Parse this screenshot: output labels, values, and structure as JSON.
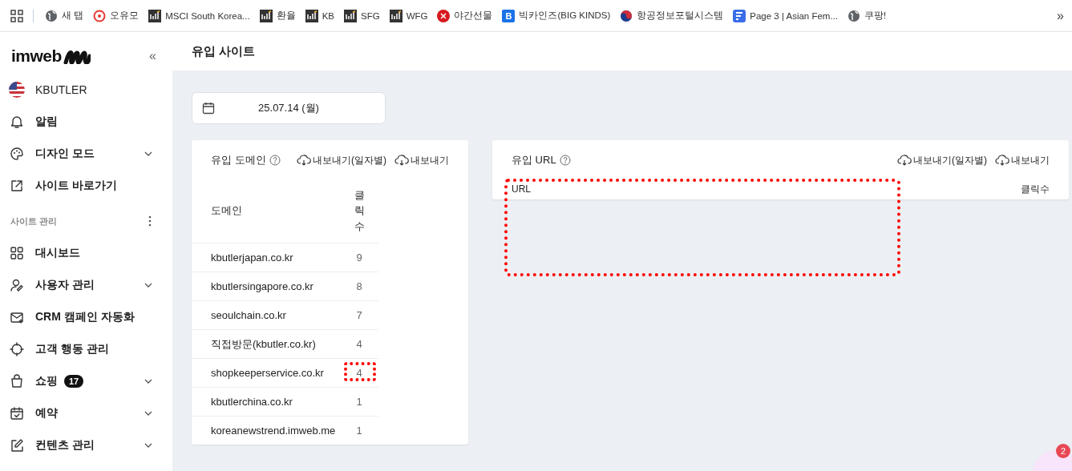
{
  "bookmarks_bar": {
    "items": [
      {
        "kind": "apps"
      },
      {
        "kind": "globe",
        "label": "새 탭"
      },
      {
        "kind": "cafe",
        "label": "오유모"
      },
      {
        "kind": "inv",
        "label": "MSCI South Korea..."
      },
      {
        "kind": "inv",
        "label": "환율"
      },
      {
        "kind": "inv",
        "label": "KB"
      },
      {
        "kind": "inv",
        "label": "SFG"
      },
      {
        "kind": "inv",
        "label": "WFG"
      },
      {
        "kind": "red",
        "label": "야간선물"
      },
      {
        "kind": "letter",
        "label": "빅카인즈(BIG KINDS)",
        "icon_text": "B"
      },
      {
        "kind": "gov",
        "label": "항공정보포털시스템"
      },
      {
        "kind": "page",
        "label": "Page 3 | Asian Fem..."
      },
      {
        "kind": "globe",
        "label": "쿠팡!"
      }
    ],
    "overflow": "»"
  },
  "sidebar": {
    "logo": "imweb",
    "collapse": "«",
    "items": [
      {
        "kind": "account",
        "label": "KBUTLER"
      },
      {
        "kind": "bell",
        "label": "알림",
        "has_submenu": false
      },
      {
        "kind": "palette",
        "label": "디자인 모드",
        "has_submenu": true
      },
      {
        "kind": "external",
        "label": "사이트 바로가기",
        "has_submenu": false
      },
      {
        "kind": "section",
        "label": "사이트 관리"
      },
      {
        "kind": "grid",
        "label": "대시보드",
        "has_submenu": false
      },
      {
        "kind": "user",
        "label": "사용자 관리",
        "has_submenu": true
      },
      {
        "kind": "mail",
        "label": "CRM 캠페인 자동화",
        "has_submenu": false
      },
      {
        "kind": "target",
        "label": "고객 행동 관리",
        "has_submenu": false
      },
      {
        "kind": "bag",
        "label": "쇼핑",
        "badge": "17",
        "has_submenu": true
      },
      {
        "kind": "calendar",
        "label": "예약",
        "has_submenu": true
      },
      {
        "kind": "edit",
        "label": "컨텐츠 관리",
        "has_submenu": true
      }
    ]
  },
  "page": {
    "title": "유입 사이트",
    "date": "25.07.14 (월)"
  },
  "domain_panel": {
    "title": "유입 도메인",
    "export_by_date": "내보내기(일자별)",
    "export": "내보내기",
    "columns": [
      "도메인",
      "클릭수"
    ],
    "rows": [
      {
        "domain": "kbutlerjapan.co.kr",
        "clicks": "9",
        "highlighted": false
      },
      {
        "domain": "kbutlersingapore.co.kr",
        "clicks": "8",
        "highlighted": false
      },
      {
        "domain": "seoulchain.co.kr",
        "clicks": "7",
        "highlighted": false
      },
      {
        "domain": "직접방문(kbutler.co.kr)",
        "clicks": "4",
        "highlighted": false
      },
      {
        "domain": "shopkeeperservice.co.kr",
        "clicks": "4",
        "highlighted": true
      },
      {
        "domain": "kbutlerchina.co.kr",
        "clicks": "1",
        "highlighted": false
      },
      {
        "domain": "koreanewstrend.imweb.me",
        "clicks": "1",
        "highlighted": false
      }
    ]
  },
  "url_panel": {
    "title": "유입 URL",
    "export_by_date": "내보내기(일자별)",
    "export": "내보내기",
    "columns": [
      "URL",
      "클릭수"
    ],
    "highlighted": true
  },
  "chat_widget": {
    "badge": "2"
  }
}
